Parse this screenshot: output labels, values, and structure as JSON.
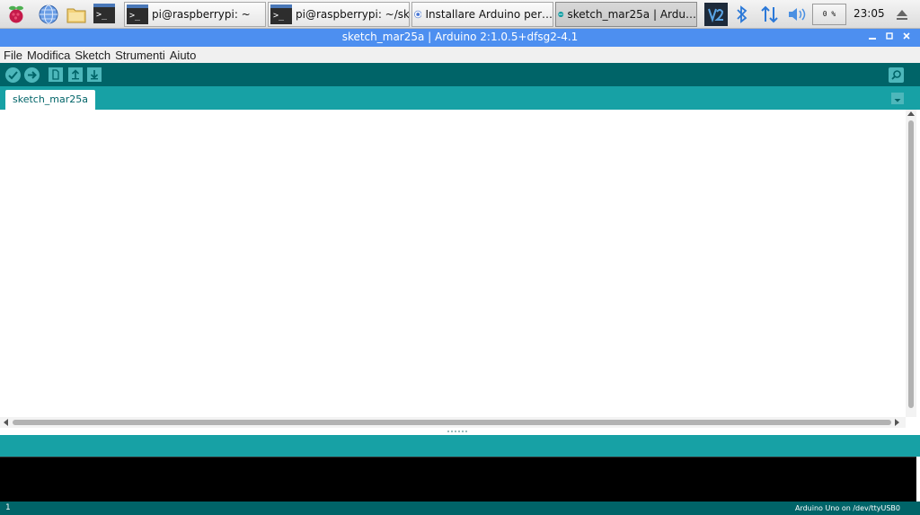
{
  "taskbar": {
    "tasks": [
      {
        "label": "pi@raspberrypi: ~"
      },
      {
        "label": "pi@raspberrypi: ~/sk…"
      },
      {
        "label": "Installare Arduino per…"
      },
      {
        "label": "sketch_mar25a | Ardu…"
      }
    ],
    "cpu": "0 %",
    "clock": "23:05",
    "terminal_glyph": ">_"
  },
  "window": {
    "title": "sketch_mar25a | Arduino 2:1.0.5+dfsg2-4.1"
  },
  "menu": {
    "items": [
      "File",
      "Modifica",
      "Sketch",
      "Strumenti",
      "Aiuto"
    ]
  },
  "tabs": [
    {
      "label": "sketch_mar25a"
    }
  ],
  "footer": {
    "line": "1",
    "board": "Arduino Uno on /dev/ttyUSB0"
  },
  "colors": {
    "titlebar": "#4d8ff0",
    "toolbar": "#006468",
    "tabrow": "#17a1a5",
    "console": "#000000"
  }
}
